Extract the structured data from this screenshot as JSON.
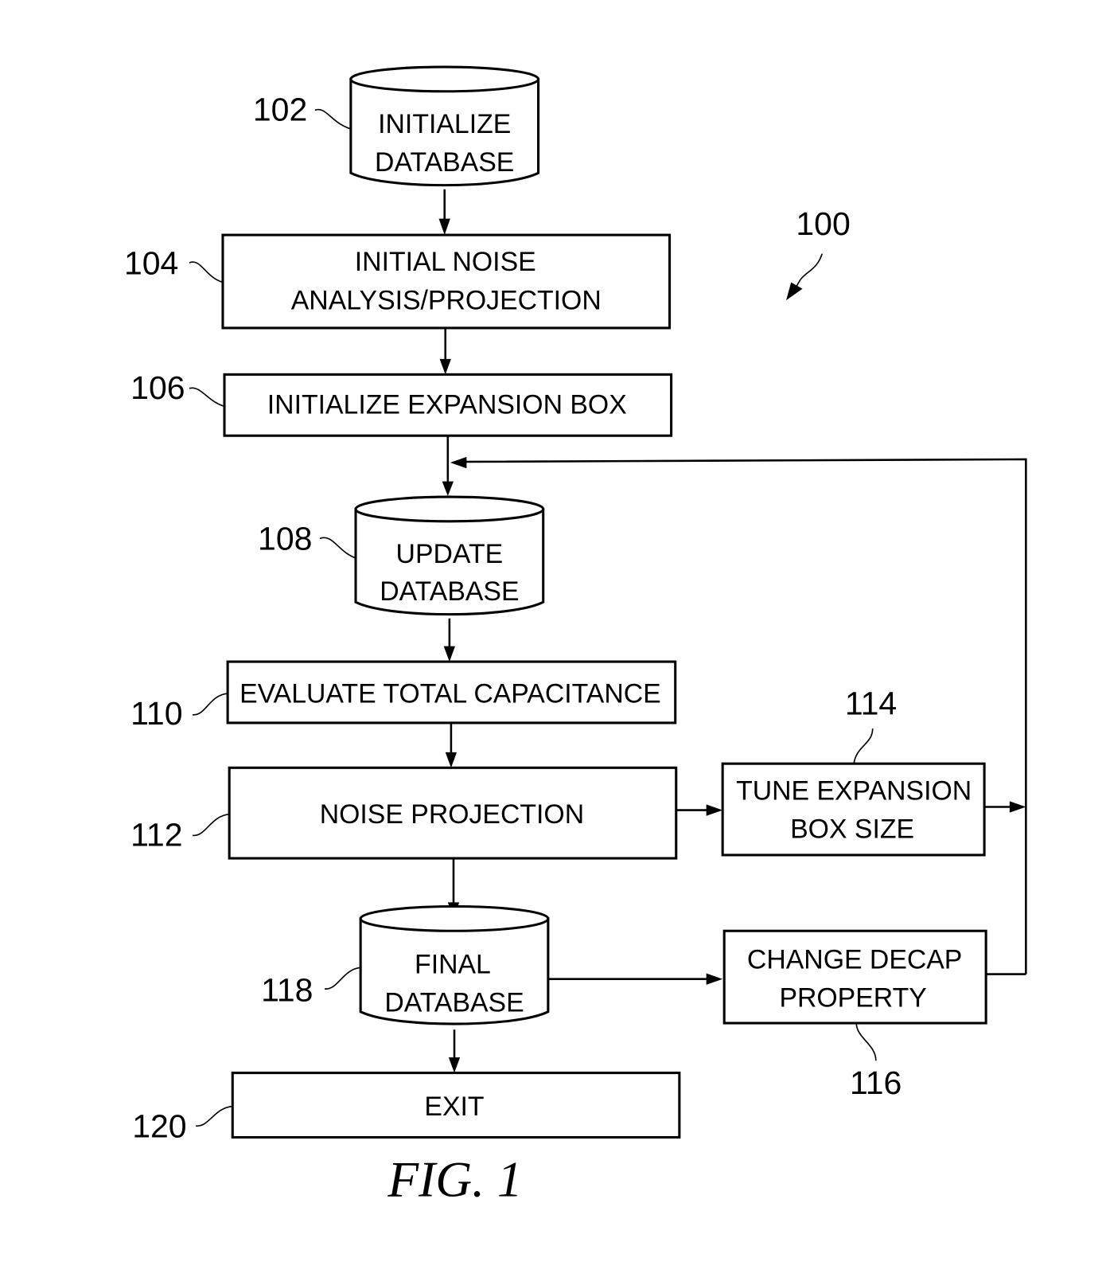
{
  "figure": {
    "caption": "FIG. 1",
    "reference": "100"
  },
  "steps": {
    "s102": {
      "ref": "102",
      "type": "database",
      "lines": [
        "INITIALIZE",
        "DATABASE"
      ]
    },
    "s104": {
      "ref": "104",
      "type": "process",
      "lines": [
        "INITIAL NOISE",
        "ANALYSIS/PROJECTION"
      ]
    },
    "s106": {
      "ref": "106",
      "type": "process",
      "lines": [
        "INITIALIZE EXPANSION BOX"
      ]
    },
    "s108": {
      "ref": "108",
      "type": "database",
      "lines": [
        "UPDATE",
        "DATABASE"
      ]
    },
    "s110": {
      "ref": "110",
      "type": "process",
      "lines": [
        "EVALUATE TOTAL CAPACITANCE"
      ]
    },
    "s112": {
      "ref": "112",
      "type": "process",
      "lines": [
        "NOISE PROJECTION"
      ]
    },
    "s114": {
      "ref": "114",
      "type": "process",
      "lines": [
        "TUNE EXPANSION",
        "BOX SIZE"
      ]
    },
    "s116": {
      "ref": "116",
      "type": "process",
      "lines": [
        "CHANGE DECAP",
        "PROPERTY"
      ]
    },
    "s118": {
      "ref": "118",
      "type": "database",
      "lines": [
        "FINAL",
        "DATABASE"
      ]
    },
    "s120": {
      "ref": "120",
      "type": "process",
      "lines": [
        "EXIT"
      ]
    }
  },
  "flows": [
    [
      "102",
      "104"
    ],
    [
      "104",
      "106"
    ],
    [
      "106",
      "108"
    ],
    [
      "108",
      "110"
    ],
    [
      "110",
      "112"
    ],
    [
      "112",
      "114"
    ],
    [
      "112",
      "118"
    ],
    [
      "114",
      "108"
    ],
    [
      "118",
      "116"
    ],
    [
      "116",
      "108"
    ],
    [
      "118",
      "120"
    ]
  ]
}
